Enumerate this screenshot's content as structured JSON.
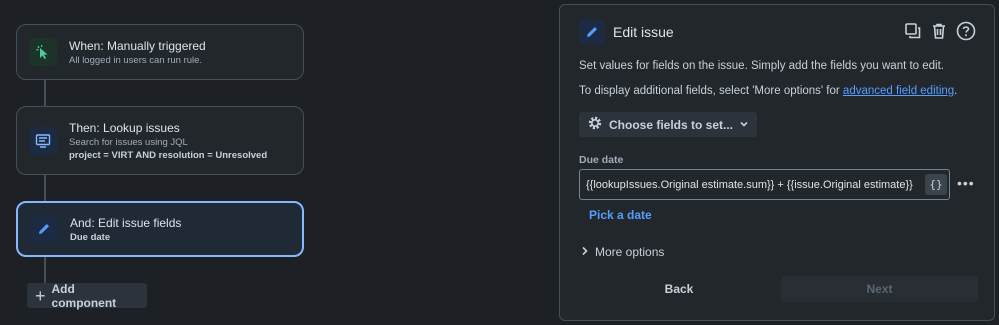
{
  "flow": {
    "trigger": {
      "title": "When: Manually triggered",
      "subtitle": "All logged in users can run rule."
    },
    "action1": {
      "title": "Then: Lookup issues",
      "subtitle": "Search for issues using JQL",
      "jql": "project = VIRT AND resolution = Unresolved"
    },
    "action2": {
      "title": "And: Edit issue fields",
      "subtitle": "Due date"
    },
    "add_component_label": "Add component"
  },
  "panel": {
    "title": "Edit issue",
    "desc1": "Set values for fields on the issue. Simply add the fields you want to edit.",
    "desc2_prefix": "To display additional fields, select 'More options' for ",
    "desc2_link": "advanced field editing",
    "desc2_suffix": ".",
    "choose_fields_label": "Choose fields to set...",
    "field_label": "Due date",
    "field_value": "{{lookupIssues.Original estimate.sum}} + {{issue.Original estimate}}",
    "brace_label": "{}",
    "pick_date_label": "Pick a date",
    "more_options_label": "More options",
    "back_label": "Back",
    "next_label": "Next"
  },
  "icons": {
    "trigger": "cursor-click-icon",
    "lookup": "monitor-list-icon",
    "edit": "pencil-icon",
    "copy": "copy-icon",
    "delete": "trash-icon",
    "help": "help-icon"
  },
  "colors": {
    "background": "#1d2125",
    "accent": "#579dff",
    "selected_border": "#85b8ff",
    "trigger_icon_bg": "#1c3329"
  }
}
